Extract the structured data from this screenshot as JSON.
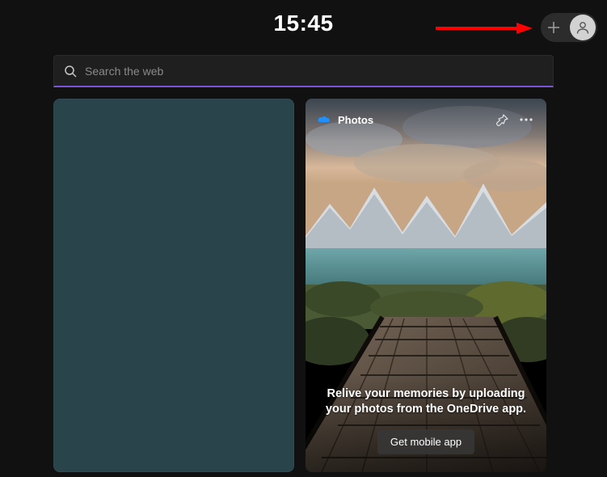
{
  "header": {
    "time": "15:45"
  },
  "search": {
    "placeholder": "Search the web"
  },
  "photosCard": {
    "title": "Photos",
    "message": "Relive your memories by uploading your photos from the OneDrive app.",
    "buttonLabel": "Get mobile app"
  }
}
